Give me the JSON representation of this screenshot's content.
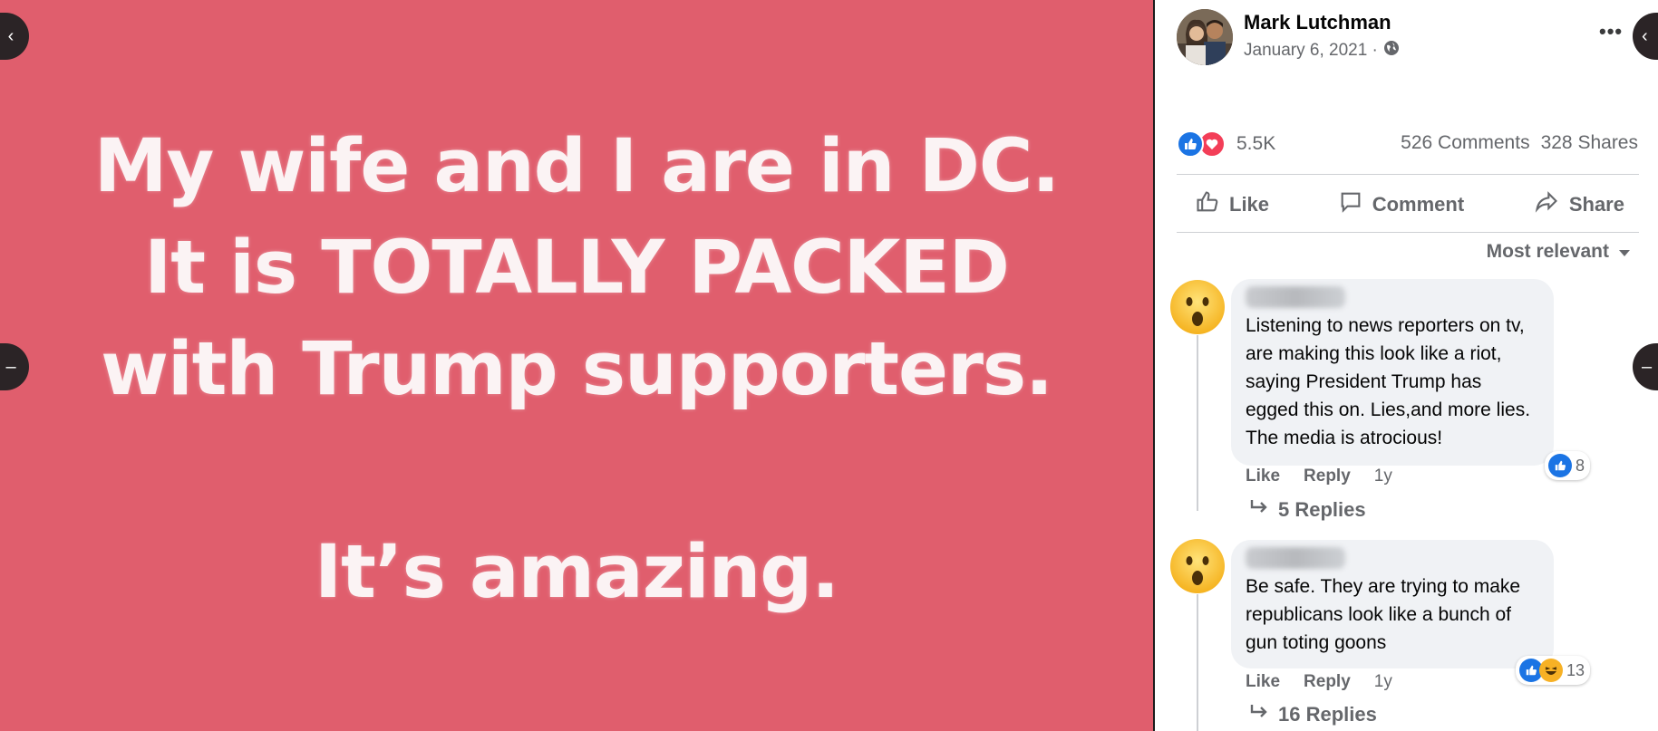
{
  "post_image": {
    "lines": [
      "My wife and I are in DC.",
      "It is TOTALLY PACKED",
      "with Trump supporters.",
      "It’s amazing."
    ],
    "background": "#e05e6d"
  },
  "post": {
    "author": "Mark Lutchman",
    "date": "January 6, 2021 ·",
    "more": "•••",
    "reaction_count": "5.5K",
    "comments": "526 Comments",
    "shares": "328 Shares"
  },
  "actions": {
    "like": "Like",
    "comment": "Comment",
    "share": "Share"
  },
  "sort_label": "Most relevant",
  "comments": [
    {
      "text": "Listening to news reporters on tv, are making this look like a riot, saying President Trump has egged this on. Lies,and more lies. The media is atrocious!",
      "reaction_count": "8",
      "like": "Like",
      "reply": "Reply",
      "time": "1y",
      "replies": "5 Replies"
    },
    {
      "text": "Be safe. They are trying to make republicans look like a bunch of gun toting goons",
      "reaction_count": "13",
      "like": "Like",
      "reply": "Reply",
      "time": "1y",
      "replies": "16 Replies"
    }
  ],
  "colors": {
    "accent": "#1b74e4",
    "love": "#f33e58",
    "muted": "#65676b",
    "bubble": "#f0f2f5"
  }
}
